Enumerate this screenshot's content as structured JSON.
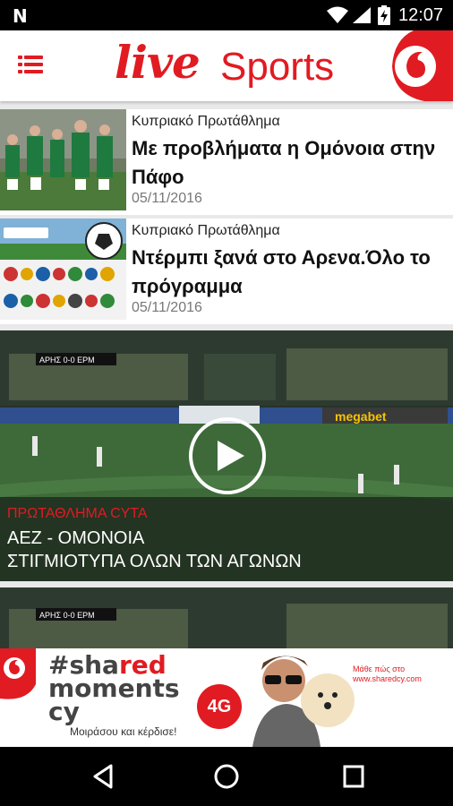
{
  "status_bar": {
    "notification_icon": "N",
    "time": "12:07",
    "icons": [
      "wifi-icon",
      "signal-icon",
      "battery-charging-icon"
    ]
  },
  "header": {
    "logo_live": "live",
    "logo_sports": "Sports",
    "menu_icon": "menu-icon",
    "brand_color": "#e11b22"
  },
  "articles": [
    {
      "category": "Κυπριακό Πρωτάθλημα",
      "title": "Με προβλήματα η Ομόνοια στην Πάφο",
      "date": "05/11/2016"
    },
    {
      "category": "Κυπριακό Πρωτάθλημα",
      "title": "Ντέρμπι ξανά στο Αρενα.Όλο το πρόγραμμα",
      "date": "05/11/2016"
    }
  ],
  "video_cards": [
    {
      "scoreboard": "ΑΡΗΣ 0-0 ΕΡΜ",
      "board_ad": "megabet",
      "kicker": "ΠΡΩΤΑΘΛΗΜΑ CYTA",
      "headline_1": "ΑΕΖ - ΟΜΟΝΟΙΑ",
      "headline_2": "ΣΤΙΓΜΙΟΤΥΠΑ ΟΛΩΝ ΤΩΝ ΑΓΩΝΩΝ"
    },
    {
      "scoreboard": "ΑΡΗΣ 0-0 ΕΡΜ"
    }
  ],
  "ad": {
    "hashtag_line1_prefix": "#sha",
    "hashtag_line1_red": "red",
    "hashtag_line2": "moments",
    "hashtag_line3": "cy",
    "tagline": "Μοιράσου και κέρδισε!",
    "badge": "4G",
    "visit_line1": "Μάθε πώς στο",
    "visit_line2": "www.sharedcy.com"
  },
  "nav": {
    "back": "back-icon",
    "home": "home-icon",
    "recents": "recents-icon"
  }
}
